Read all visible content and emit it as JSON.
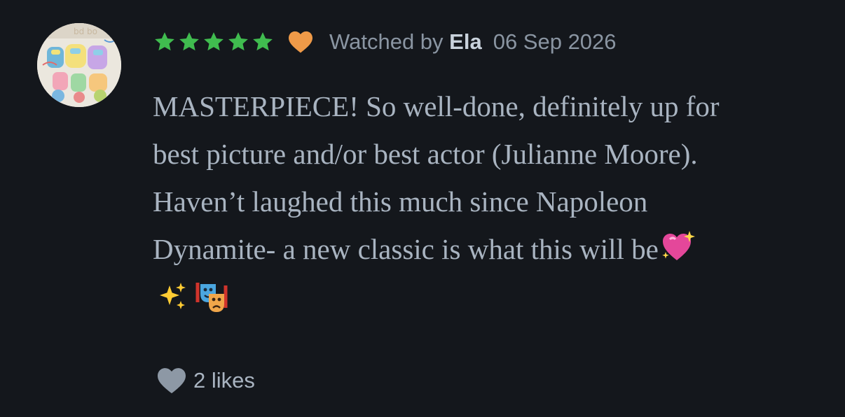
{
  "review": {
    "rating_stars": 5,
    "liked": true,
    "watched_prefix": "Watched by",
    "reviewer_name": "Ela",
    "date": "06 Sep 2026",
    "text_lines": [
      "MASTERPIECE! So well-done, definitely up for",
      "best picture and/or best actor (Julianne Moore).",
      "Haven’t laughed this much since Napoleon",
      "Dynamite- a new classic is what this will be"
    ],
    "trailing_emojis": [
      "sparkling-heart-emoji",
      "sparkles-emoji",
      "performing-arts-emoji"
    ],
    "likes_label": "2 likes"
  },
  "colors": {
    "background": "#14171c",
    "star_green": "#40bc4f",
    "heart_orange": "#ef9a48",
    "muted_text": "#8a95a2",
    "body_text": "#a9b4c1",
    "like_heart_gray": "#8d98a5"
  }
}
